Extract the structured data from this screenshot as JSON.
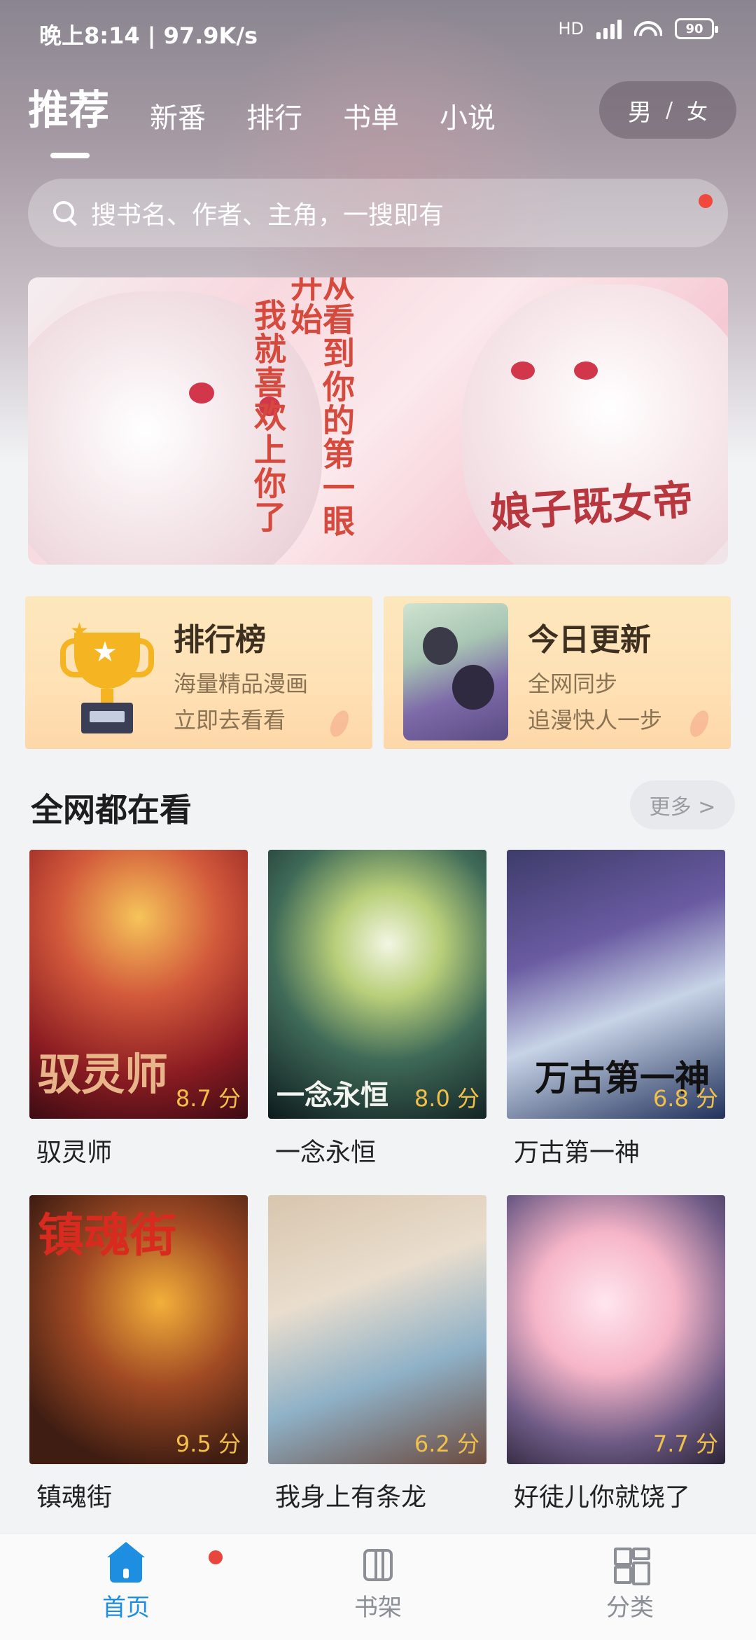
{
  "status_bar": {
    "time": "晚上8:14 | 97.9K/s",
    "network": "HD",
    "battery": "90"
  },
  "top_tabs": [
    {
      "label": "推荐",
      "active": true
    },
    {
      "label": "新番"
    },
    {
      "label": "排行"
    },
    {
      "label": "书单"
    },
    {
      "label": "小说"
    }
  ],
  "gender_toggle": {
    "male": "男",
    "sep": "/",
    "female": "女"
  },
  "search": {
    "placeholder": "搜书名、作者、主角，一搜即有"
  },
  "banner": {
    "text_col1": "我就喜欢上你了",
    "text_col2": "从看到你的第一眼开始",
    "logo": "娘子既女帝"
  },
  "cards": [
    {
      "title": "排行榜",
      "line1": "海量精品漫画",
      "line2": "立即去看看"
    },
    {
      "title": "今日更新",
      "line1": "全网同步",
      "line2": "追漫快人一步"
    }
  ],
  "section": {
    "title": "全网都在看",
    "more": "更多 >"
  },
  "comics": [
    {
      "name": "驭灵师",
      "score": "8.7 分",
      "cover_text": "驭灵师"
    },
    {
      "name": "一念永恒",
      "score": "8.0 分",
      "cover_text": "一念永恒"
    },
    {
      "name": "万古第一神",
      "score": "6.8 分",
      "cover_text": "万古第一神"
    },
    {
      "name": "镇魂街",
      "score": "9.5 分",
      "cover_text": "镇魂街"
    },
    {
      "name": "我身上有条龙",
      "score": "6.2 分",
      "cover_text": ""
    },
    {
      "name": "好徒儿你就饶了",
      "score": "7.7 分",
      "cover_text": ""
    }
  ],
  "bottom_nav": [
    {
      "label": "首页",
      "active": true
    },
    {
      "label": "书架"
    },
    {
      "label": "分类"
    }
  ],
  "colors": {
    "accent": "#1e8fe0",
    "score": "#f0c04b",
    "badge": "#e8453c"
  }
}
